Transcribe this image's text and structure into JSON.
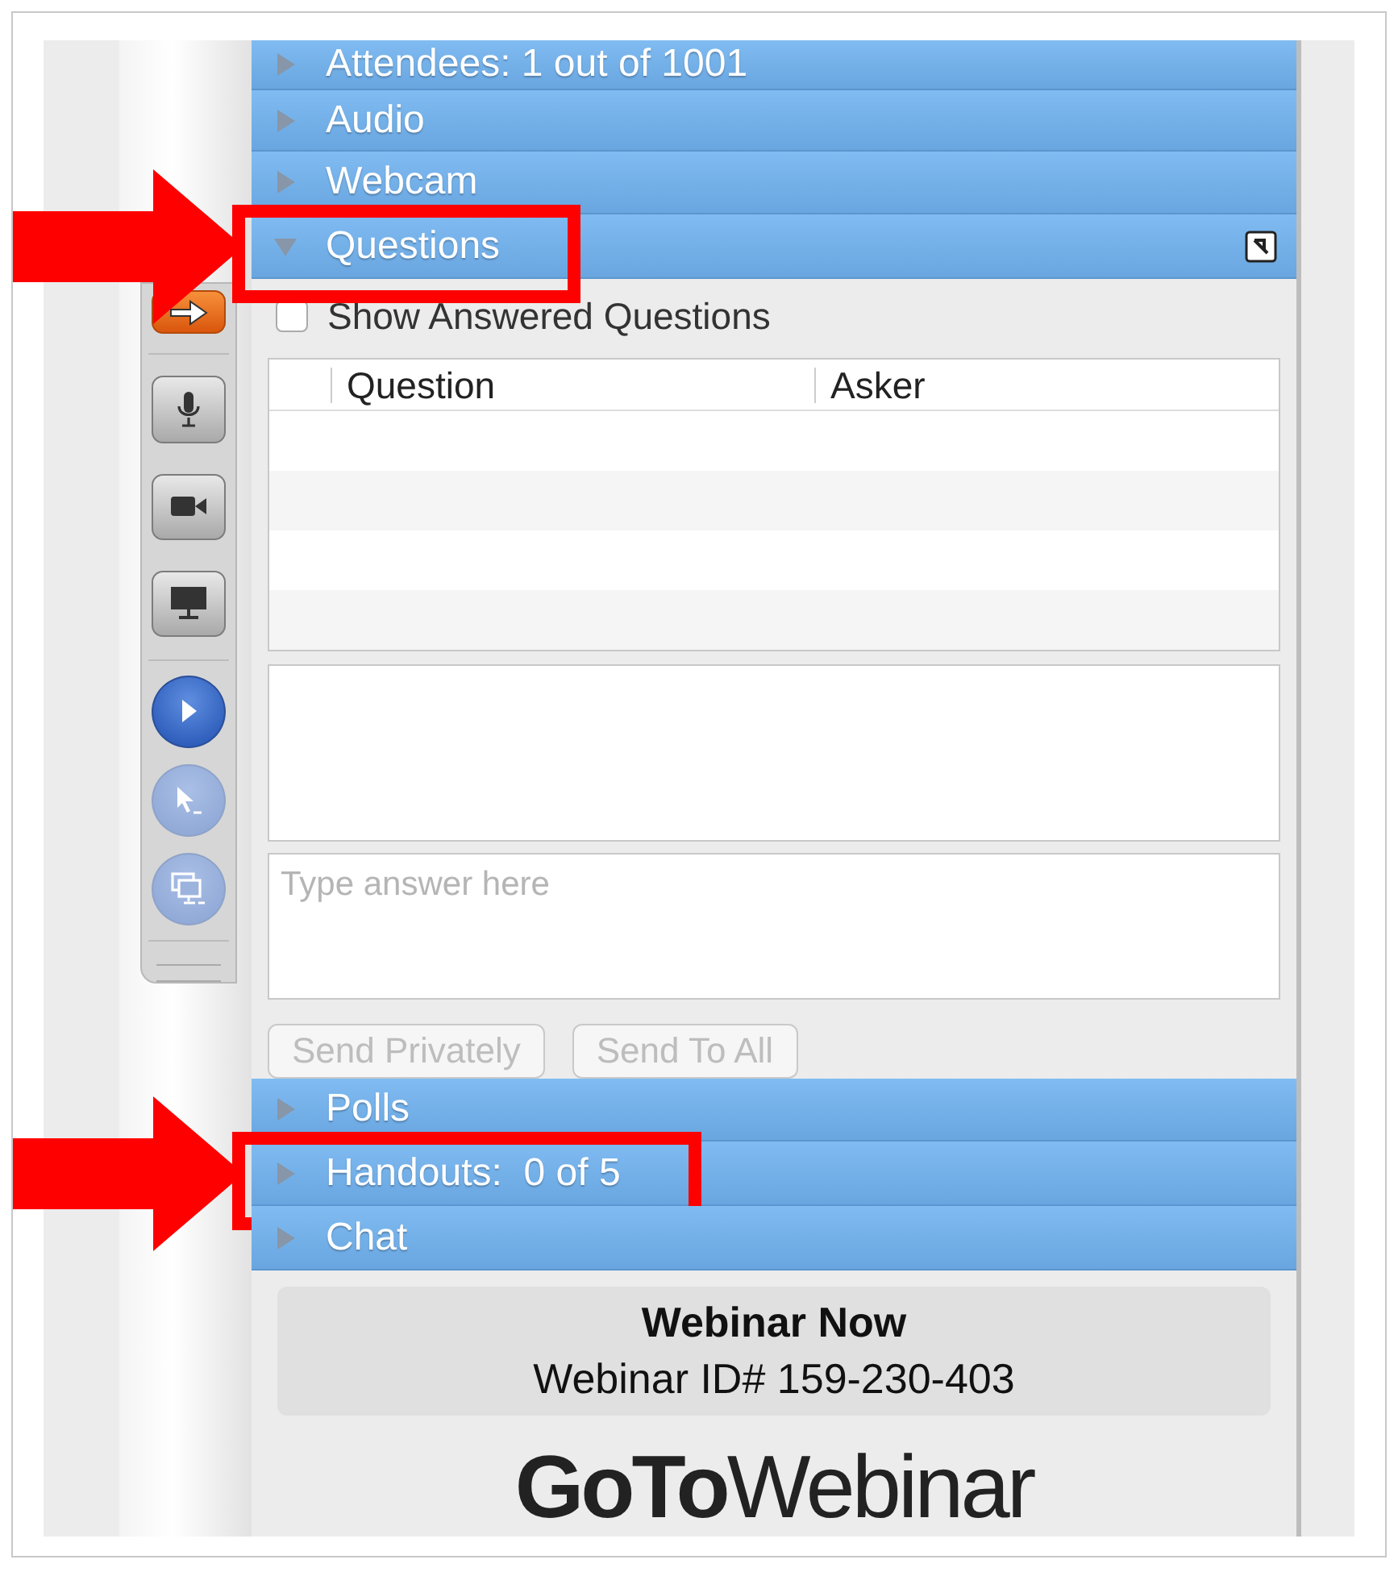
{
  "sections": [
    {
      "title": "Attendees: 1 out of 1001",
      "expanded": false,
      "highlighted": false
    },
    {
      "title": "Audio",
      "expanded": false,
      "highlighted": false
    },
    {
      "title": "Webcam",
      "expanded": false,
      "highlighted": false
    },
    {
      "title": "Questions",
      "expanded": true,
      "highlighted": true,
      "popout": true,
      "show_answered": {
        "label": "Show Answered Questions",
        "checked": false
      },
      "columns": [
        "Question",
        "Asker"
      ],
      "answer_placeholder": "Type answer here",
      "buttons": [
        {
          "label": "Send Privately",
          "disabled": true
        },
        {
          "label": "Send To All",
          "disabled": true
        }
      ]
    },
    {
      "title": "Polls",
      "expanded": false,
      "highlighted": false
    },
    {
      "title": "Handouts:  0 of 5",
      "expanded": false,
      "highlighted": true
    },
    {
      "title": "Chat",
      "expanded": false,
      "highlighted": false
    }
  ],
  "toolbar": [
    {
      "kind": "square"
    },
    {
      "kind": "square"
    },
    {
      "kind": "square"
    },
    {
      "kind": "square"
    },
    {
      "kind": "round"
    },
    {
      "kind": "round"
    },
    {
      "kind": "round"
    }
  ],
  "footer": {
    "title": "Webinar Now",
    "webinar_id": "Webinar ID# 159-230-403",
    "logo": "**GoTo**Webinar"
  }
}
